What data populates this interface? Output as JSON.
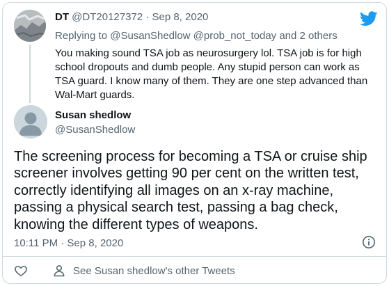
{
  "quoted": {
    "name": "DT",
    "handle": "@DT20127372",
    "separator": "·",
    "date": "Sep 8, 2020",
    "replying_prefix": "Replying to",
    "replying_handles": "@SusanShedlow @prob_not_today",
    "replying_suffix": "and 2 others",
    "body": "You making sound TSA job as neurosurgery lol. TSA job is for high school dropouts and dumb people. Any stupid person can work as TSA guard. I know many of them. They are one step advanced than Wal-Mart guards."
  },
  "main": {
    "name": "Susan shedlow",
    "handle": "@SusanShedlow",
    "text": "The screening process for becoming a TSA or cruise ship screener involves getting 90 per cent on the written test, correctly identifying all images on an x-ray machine, passing a physical search test, passing a bag check, knowing the different types of weapons.",
    "timestamp": "10:11 PM · Sep 8, 2020"
  },
  "footer": {
    "other_tweets": "See Susan shedlow's other Tweets"
  },
  "icons": {
    "brand": "twitter-bird-icon",
    "info": "info-icon",
    "like": "heart-icon",
    "profile": "person-icon"
  },
  "colors": {
    "twitter_blue": "#1d9bf0",
    "secondary_text": "#536471",
    "border": "#cfd9de"
  }
}
